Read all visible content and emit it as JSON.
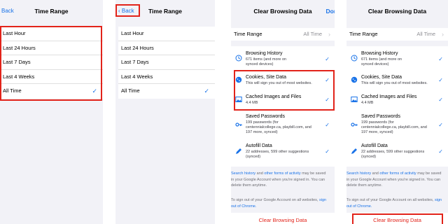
{
  "p1": {
    "back": "Back",
    "title": "Time Range",
    "options": [
      {
        "label": "Last Hour",
        "checked": false
      },
      {
        "label": "Last 24 Hours",
        "checked": false
      },
      {
        "label": "Last 7 Days",
        "checked": false
      },
      {
        "label": "Last 4 Weeks",
        "checked": false
      },
      {
        "label": "All Time",
        "checked": true
      }
    ]
  },
  "p2": {
    "back": "Back",
    "title": "Time Range",
    "options": [
      {
        "label": "Last Hour"
      },
      {
        "label": "Last 24 Hours"
      },
      {
        "label": "Last 7 Days"
      },
      {
        "label": "Last 4 Weeks"
      },
      {
        "label": "All Time"
      }
    ]
  },
  "p3": {
    "title": "Clear Browsing Data",
    "done": "Don",
    "time_range_label": "Time Range",
    "time_range_value": "All Time",
    "items": [
      {
        "title": "Browsing History",
        "sub": [
          "671 items (and more on",
          "synced devices)"
        ],
        "icon": "history-icon"
      },
      {
        "title": "Cookies, Site Data",
        "sub": [
          "This will sign you out of most websites."
        ],
        "icon": "cookie-icon"
      },
      {
        "title": "Cached Images and Files",
        "sub": [
          "4.4 MB"
        ],
        "icon": "image-icon"
      },
      {
        "title": "Saved Passwords",
        "sub": [
          "199 passwords (for",
          "centennialcollege.ca, playbill.com, and",
          "197 more, synced)"
        ],
        "icon": "key-icon"
      },
      {
        "title": "Autofill Data",
        "sub": [
          "22 addresses, 599 other suggestions",
          "(synced)"
        ],
        "icon": "autofill-icon"
      }
    ],
    "note": {
      "link1": "Search history",
      "t1": " and ",
      "link2": "other forms of activity",
      "t2": " may be saved",
      "l2": "in your Google Account when you're signed in. You can",
      "l3": "delete them anytime."
    },
    "signout": {
      "l1": "To sign out of your Google Account on all websites,",
      "link": "sign",
      "l2": "out of Chrome."
    },
    "clear": "Clear Browsing Data"
  },
  "p4": {
    "title": "Clear Browsing Data",
    "time_range_label": "Time Range",
    "time_range_value": "All Time",
    "items": [
      {
        "title": "Browsing History",
        "sub": [
          "671 items (and more on",
          "synced devices)"
        ],
        "icon": "history-icon"
      },
      {
        "title": "Cookies, Site Data",
        "sub": [
          "This will sign you out of most websites."
        ],
        "icon": "cookie-icon"
      },
      {
        "title": "Cached Images and Files",
        "sub": [
          "4.4 MB"
        ],
        "icon": "image-icon"
      },
      {
        "title": "Saved Passwords",
        "sub": [
          "199 passwords (for",
          "centennialcollege.ca, playbill.com, and",
          "197 more, synced)"
        ],
        "icon": "key-icon"
      },
      {
        "title": "Autofill Data",
        "sub": [
          "22 addresses, 599 other suggestions",
          "(synced)"
        ],
        "icon": "autofill-icon"
      }
    ],
    "note": {
      "link1": "Search history",
      "t1": " and ",
      "link2": "other forms of activity",
      "t2": " may be saved",
      "l2": "in your Google Account when you're signed in. You can",
      "l3": "delete them anytime."
    },
    "signout": {
      "l1": "To sign out of your Google Account on all websites,",
      "link": "sign",
      "l2": "out of Chrome."
    },
    "clear": "Clear Browsing Data"
  },
  "colors": {
    "accent": "#1a73e8",
    "highlight": "#e2231a",
    "background": "#f2f2f7"
  }
}
